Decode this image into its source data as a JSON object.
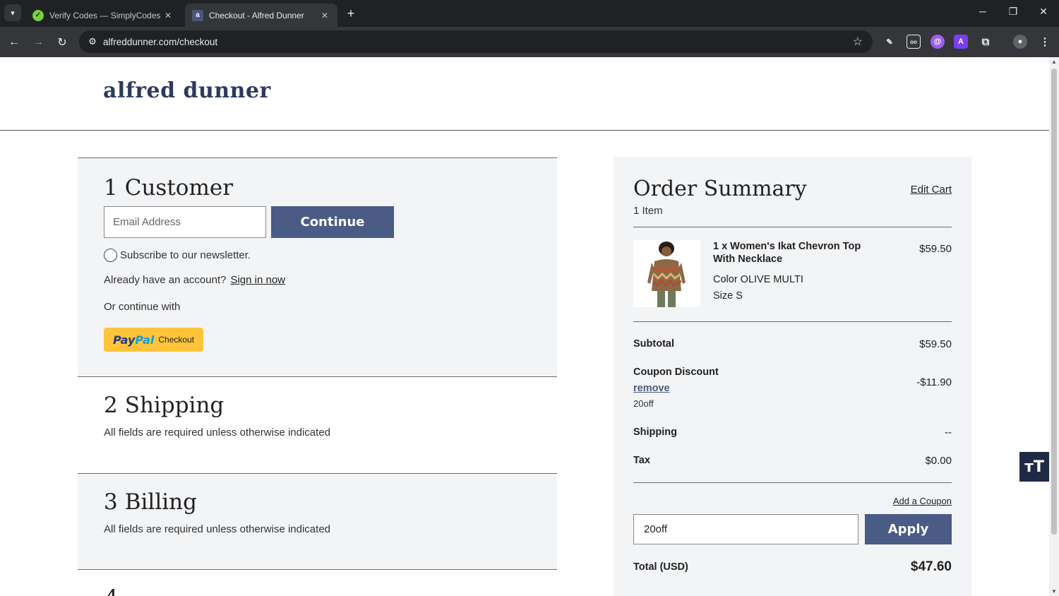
{
  "browser": {
    "tabs": [
      {
        "title": "Verify Codes — SimplyCodes",
        "active": false
      },
      {
        "title": "Checkout - Alfred Dunner",
        "active": true
      }
    ],
    "url": "alfreddunner.com/checkout",
    "extensions": [
      "pen-icon",
      "reader-icon",
      "swirl-icon",
      "a-icon",
      "puzzle-icon",
      "profile-icon"
    ]
  },
  "site": {
    "logo_text": "alfred dunner"
  },
  "checkout": {
    "customer": {
      "num": "1",
      "title": "Customer",
      "email_placeholder": "Email Address",
      "continue_label": "Continue",
      "newsletter_label": "Subscribe to our newsletter.",
      "account_prompt": "Already have an account?",
      "sign_in_label": "Sign in now",
      "continue_with": "Or continue with",
      "paypal_pay": "Pay",
      "paypal_pal": "Pal",
      "paypal_checkout": "Checkout"
    },
    "shipping": {
      "num": "2",
      "title": "Shipping",
      "note": "All fields are required unless otherwise indicated"
    },
    "billing": {
      "num": "3",
      "title": "Billing",
      "note": "All fields are required unless otherwise indicated"
    }
  },
  "summary": {
    "title": "Order Summary",
    "edit_cart": "Edit Cart",
    "item_count": "1 Item",
    "product": {
      "name": "1 x Women's Ikat Chevron Top With Necklace",
      "price": "$59.50",
      "color": "Color OLIVE MULTI",
      "size": "Size S"
    },
    "subtotal_label": "Subtotal",
    "subtotal_value": "$59.50",
    "coupon_label": "Coupon Discount",
    "coupon_value": "-$11.90",
    "remove_label": "remove",
    "coupon_code": "20off",
    "shipping_label": "Shipping",
    "shipping_value": "--",
    "tax_label": "Tax",
    "tax_value": "$0.00",
    "add_coupon": "Add a Coupon",
    "coupon_input_value": "20off",
    "apply_label": "Apply",
    "total_label": "Total (USD)",
    "total_value": "$47.60"
  },
  "colors": {
    "brand_navy": "#2e3a5c",
    "button_blue": "#4a5b85",
    "paypal_yellow": "#ffc439",
    "panel_gray": "#f3f4f6"
  }
}
